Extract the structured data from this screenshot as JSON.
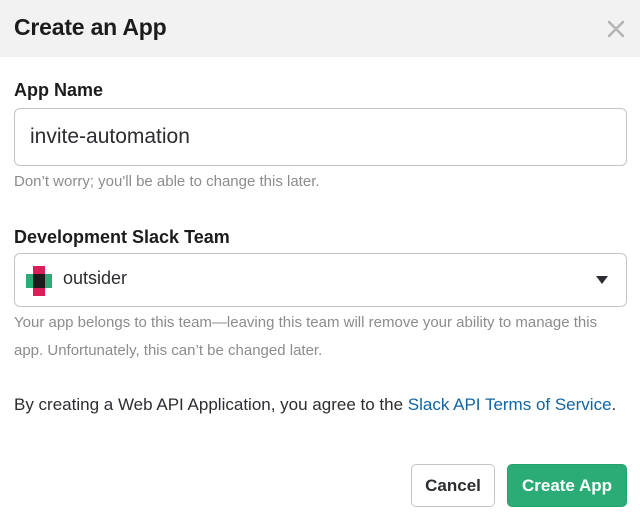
{
  "dialog": {
    "title": "Create an App",
    "close_icon": "close-icon"
  },
  "app_name": {
    "label": "App Name",
    "value": "invite-automation",
    "hint": "Don’t worry; you'll be able to change this later."
  },
  "team": {
    "label": "Development Slack Team",
    "selected": "outsider",
    "logo_icon": "team-logo-icon",
    "caret_icon": "chevron-down-icon",
    "hint": "Your app belongs to this team—leaving this team will remove your ability to manage this app. Unfortunately, this can’t be changed later."
  },
  "terms": {
    "text_before": "By creating a Web API Application, you agree to the ",
    "link_text": "Slack API Terms of Service",
    "text_after": "."
  },
  "buttons": {
    "cancel": "Cancel",
    "create": "Create App"
  },
  "colors": {
    "header_bg": "#f2f2f3",
    "primary": "#2bac76",
    "link": "#1264a3",
    "hint": "#8c8c8f"
  }
}
